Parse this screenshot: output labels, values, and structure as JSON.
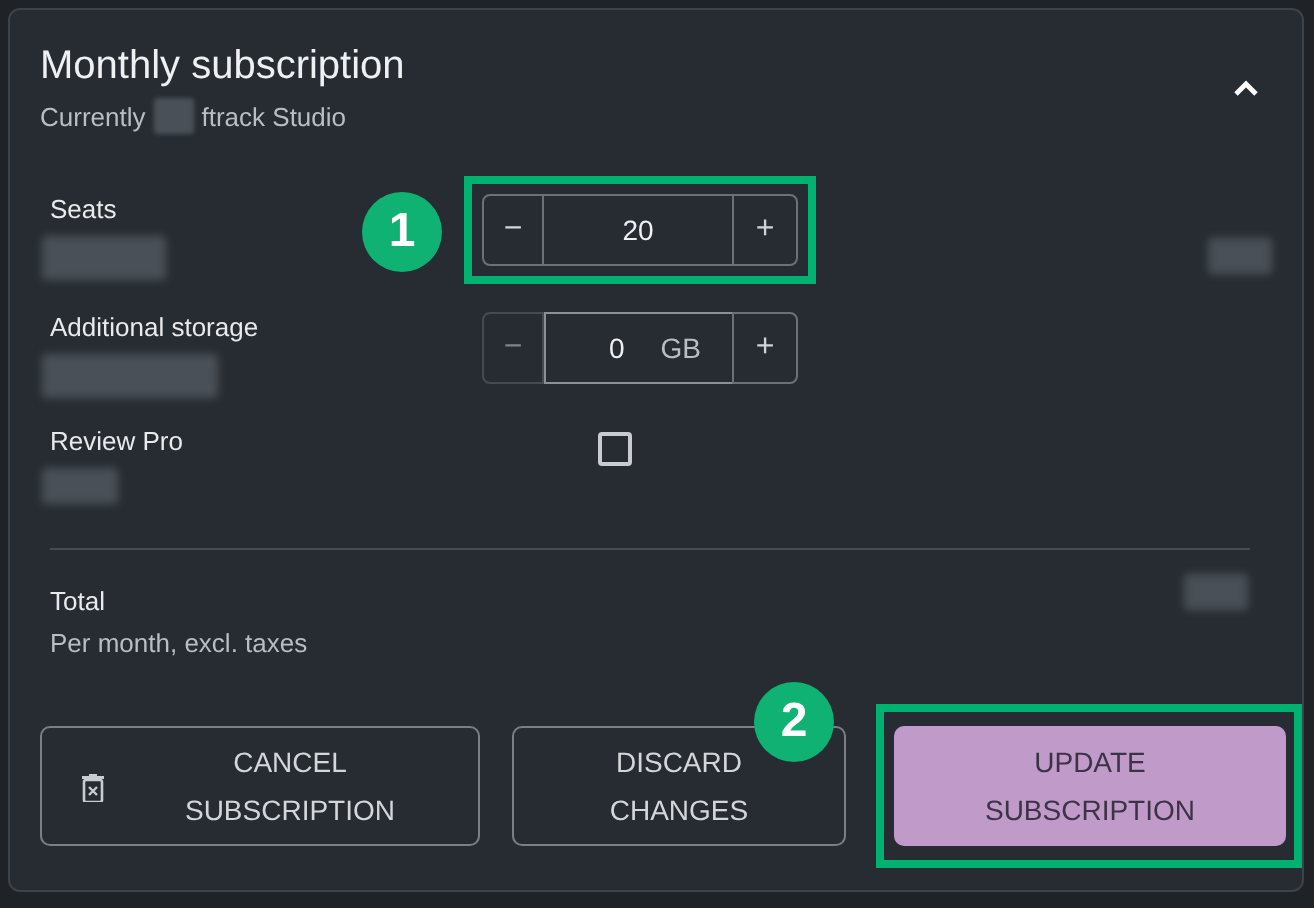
{
  "card": {
    "title": "Monthly subscription",
    "subtitle_prefix": "Currently",
    "subtitle_suffix": "ftrack Studio",
    "expanded": true
  },
  "items": [
    {
      "kind": "stepper",
      "label": "Seats",
      "value": "20",
      "minus": "−",
      "plus": "+",
      "minus_disabled": false,
      "highlight": true,
      "badge": "1"
    },
    {
      "kind": "stepper",
      "label": "Additional storage",
      "value": "0",
      "unit": "GB",
      "minus": "−",
      "plus": "+",
      "minus_disabled": true
    },
    {
      "kind": "checkbox",
      "label": "Review Pro",
      "checked": false
    }
  ],
  "total": {
    "label": "Total",
    "note": "Per month, excl. taxes"
  },
  "buttons": [
    {
      "kind": "danger",
      "label": "CANCEL SUBSCRIPTION"
    },
    {
      "kind": "outline",
      "label": "DISCARD CHANGES",
      "badge": "2"
    },
    {
      "kind": "primary",
      "label": "UPDATE SUBSCRIPTION",
      "highlight": true
    }
  ]
}
